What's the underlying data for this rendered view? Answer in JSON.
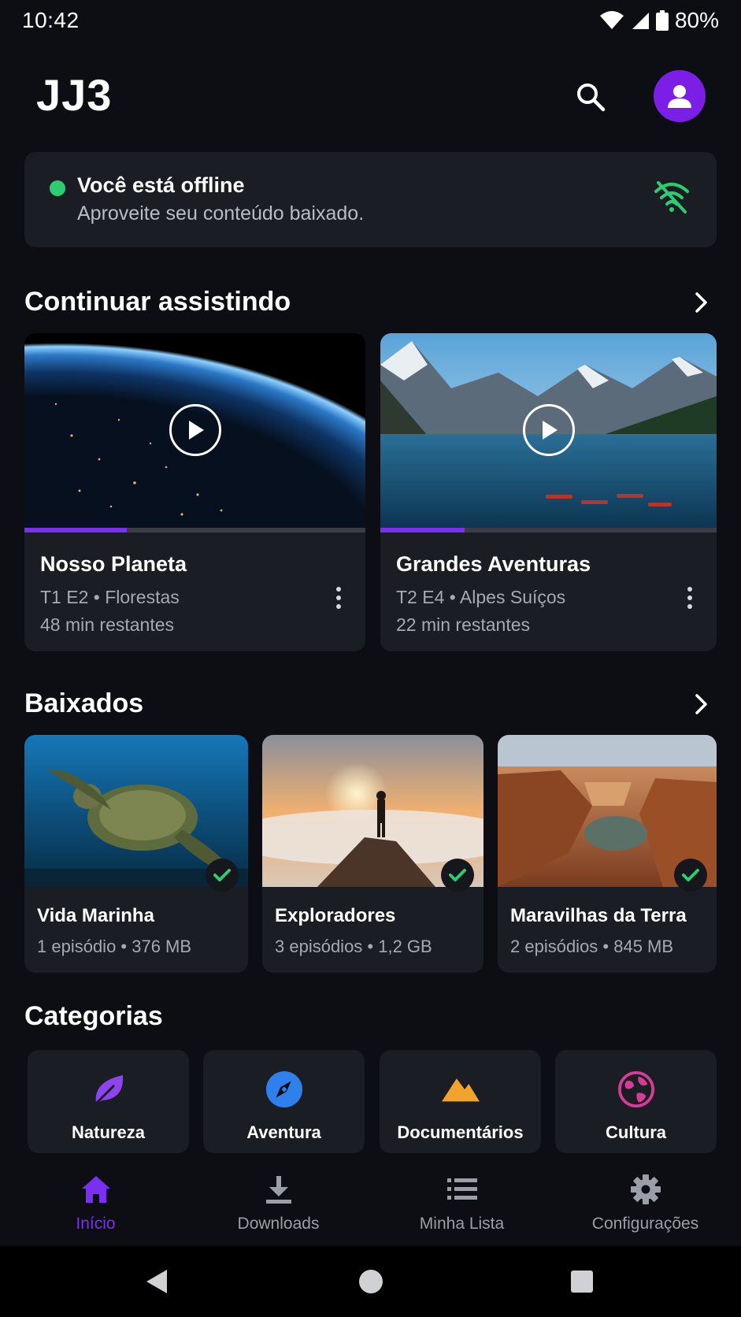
{
  "status_bar": {
    "time": "10:42",
    "battery": "80%"
  },
  "header": {
    "title": "JJ3",
    "icons": [
      "search-icon",
      "profile-icon"
    ]
  },
  "offline_banner": {
    "title": "Você está offline",
    "subtitle": "Aproveite seu conteúdo baixado.",
    "icon": "wifi-off-icon",
    "status_color": "#2ecc71"
  },
  "continue_watching": {
    "title": "Continuar assistindo",
    "items": [
      {
        "title": "Nosso Planeta",
        "meta": "T1 E2 • Florestas",
        "remaining": "48 min restantes",
        "progress": 0.3
      },
      {
        "title": "Grandes Aventuras",
        "meta": "T2 E4 • Alpes Suíços",
        "remaining": "22 min restantes",
        "progress": 0.25
      }
    ]
  },
  "downloaded": {
    "title": "Baixados",
    "items": [
      {
        "title": "Vida Marinha",
        "meta": "1 episódio • 376 MB"
      },
      {
        "title": "Exploradores",
        "meta": "3 episódios • 1,2 GB"
      },
      {
        "title": "Maravilhas da Terra",
        "meta": "2 episódios • 845 MB"
      }
    ]
  },
  "categories": {
    "title": "Categorias",
    "items": [
      {
        "label": "Natureza",
        "icon": "leaf-icon",
        "color": "#8e44ec"
      },
      {
        "label": "Aventura",
        "icon": "compass-icon",
        "color": "#2f80ed"
      },
      {
        "label": "Documentários",
        "icon": "mountain-icon",
        "color": "#f2a32b"
      },
      {
        "label": "Cultura",
        "icon": "globe-icon",
        "color": "#d63c96"
      }
    ]
  },
  "bottom_nav": {
    "items": [
      {
        "label": "Início",
        "icon": "home-icon",
        "active": true
      },
      {
        "label": "Downloads",
        "icon": "download-icon",
        "active": false
      },
      {
        "label": "Minha Lista",
        "icon": "list-icon",
        "active": false
      },
      {
        "label": "Configurações",
        "icon": "gear-icon",
        "active": false
      }
    ]
  },
  "colors": {
    "accent": "#7b2ff0",
    "background": "#0c0e13",
    "card": "#1a1d24"
  }
}
